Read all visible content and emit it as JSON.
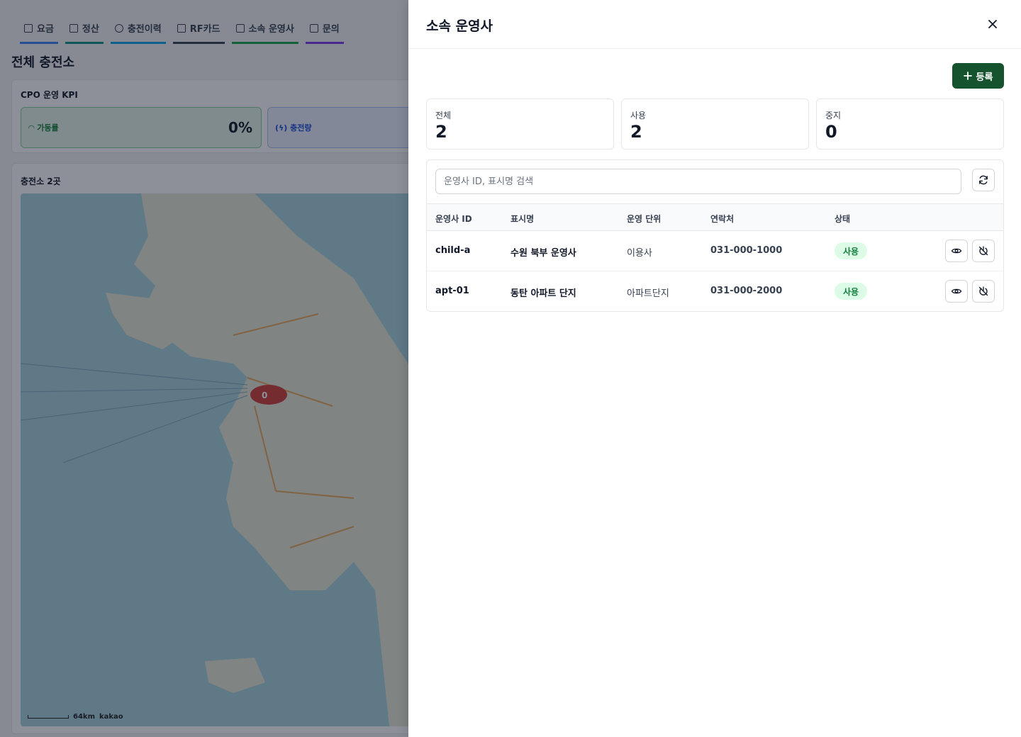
{
  "background": {
    "tabs": [
      {
        "label": "요금"
      },
      {
        "label": "정산"
      },
      {
        "label": "충전이력"
      },
      {
        "label": "RF카드"
      },
      {
        "label": "소속 운영사"
      },
      {
        "label": "문의"
      }
    ],
    "page_title": "전체 충전소",
    "kpi": {
      "title": "CPO 운영 KPI",
      "utilization_label": "가동률",
      "utilization_value": "0%",
      "charge_label": "충전량"
    },
    "map": {
      "title": "충전소 2곳",
      "marker_label": "0",
      "scale_label": "64km",
      "provider": "kakao"
    }
  },
  "drawer": {
    "title": "소속 운영사",
    "register_label": "등록",
    "stats": [
      {
        "label": "전체",
        "value": "2"
      },
      {
        "label": "사용",
        "value": "2"
      },
      {
        "label": "중지",
        "value": "0"
      }
    ],
    "search_placeholder": "운영사 ID, 표시명 검색",
    "columns": {
      "id": "운영사 ID",
      "name": "표시명",
      "unit": "운영 단위",
      "phone": "연락처",
      "status": "상태"
    },
    "rows": [
      {
        "id": "child-a",
        "name": "수원 북부 운영사",
        "unit": "이용사",
        "phone": "031-000-1000",
        "status": "사용"
      },
      {
        "id": "apt-01",
        "name": "동탄 아파트 단지",
        "unit": "아파트단지",
        "phone": "031-000-2000",
        "status": "사용"
      }
    ]
  },
  "colors": {
    "primary": "#14532d",
    "badge_bg": "#dcfce7",
    "badge_text": "#15803d",
    "overlay": "rgba(17,24,39,0.48)"
  }
}
